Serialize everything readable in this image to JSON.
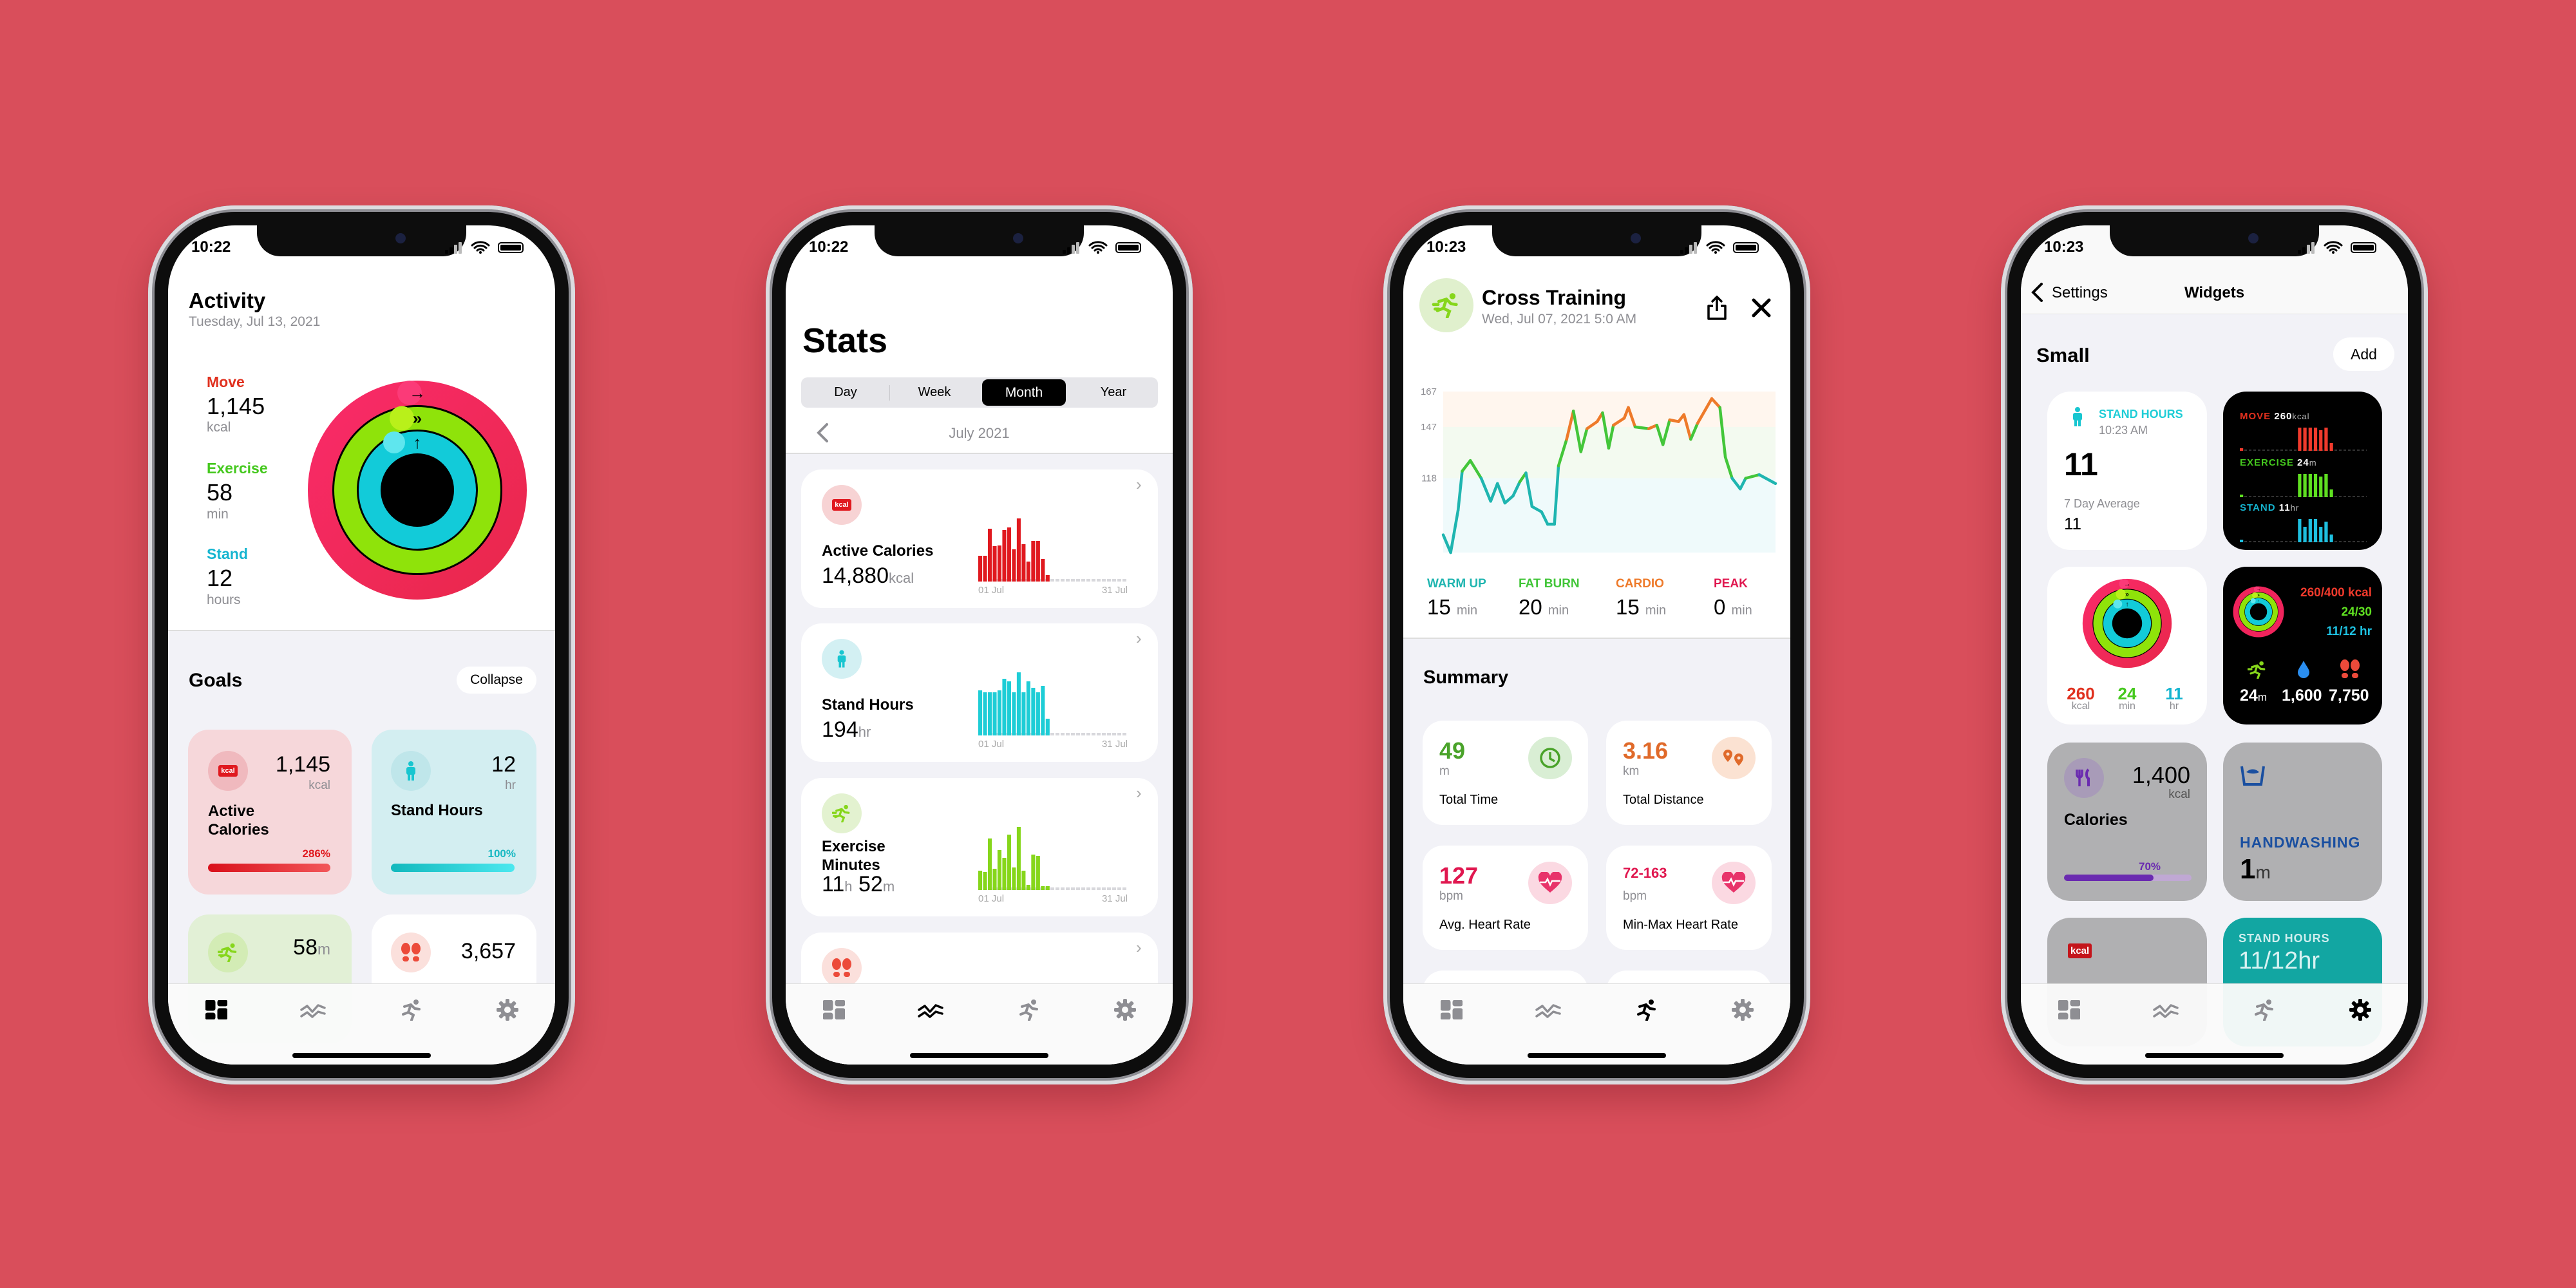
{
  "colors": {
    "background": "#d94e5b",
    "move": "#f0245c",
    "exercise": "#8fe30a",
    "stand": "#10c8d8",
    "warm_up": "#1fb5b0",
    "fat_burn": "#43c63a",
    "cardio": "#ee7a2a",
    "peak": "#e0174f"
  },
  "tabs": [
    {
      "icon": "dashboard-icon"
    },
    {
      "icon": "trends-icon"
    },
    {
      "icon": "workout-runner-icon"
    },
    {
      "icon": "settings-gear-icon"
    }
  ],
  "phones": [
    {
      "time": "10:22",
      "active_tab": 0
    },
    {
      "time": "10:22",
      "active_tab": 1
    },
    {
      "time": "10:23",
      "active_tab": 2
    },
    {
      "time": "10:23",
      "active_tab": 3
    }
  ],
  "activity": {
    "title": "Activity",
    "date": "Tuesday, Jul 13, 2021",
    "move": {
      "label": "Move",
      "value": "1,145",
      "unit": "kcal"
    },
    "exercise": {
      "label": "Exercise",
      "value": "58",
      "unit": "min"
    },
    "stand": {
      "label": "Stand",
      "value": "12",
      "unit": "hours"
    },
    "goals_title": "Goals",
    "collapse_label": "Collapse",
    "cards": [
      {
        "title": "Active Calories",
        "value": "1,145",
        "unit": "kcal",
        "percent": "286%",
        "progress": 286,
        "icon_text": "kcal"
      },
      {
        "title": "Stand Hours",
        "value": "12",
        "unit": "hr",
        "percent": "100%",
        "progress": 100
      },
      {
        "value": "58",
        "unit": "m"
      },
      {
        "value": "3,657"
      }
    ]
  },
  "stats": {
    "title": "Stats",
    "segments": [
      "Day",
      "Week",
      "Month",
      "Year"
    ],
    "selected_segment": "Month",
    "period": "July 2021",
    "axis_start": "01 Jul",
    "axis_end": "31 Jul",
    "cards": [
      {
        "title": "Active Calories",
        "value": "14,880",
        "unit": "kcal",
        "icon_text": "kcal",
        "color": "#e0191f",
        "daily": [
          40,
          40,
          82,
          55,
          56,
          80,
          84,
          50,
          98,
          58,
          31,
          63,
          63,
          35,
          10
        ]
      },
      {
        "title": "Stand Hours",
        "value": "194",
        "unit": "hr",
        "color": "#1ecdd6",
        "daily": [
          70,
          67,
          67,
          67,
          70,
          88,
          84,
          67,
          98,
          67,
          84,
          74,
          67,
          77,
          26
        ]
      },
      {
        "title": "Exercise Minutes",
        "value_h": "11",
        "unit_h": "h",
        "value_m": "52",
        "unit_m": "m",
        "color": "#86d61b",
        "daily": [
          30,
          28,
          80,
          33,
          62,
          50,
          86,
          35,
          98,
          30,
          8,
          55,
          53,
          6,
          6
        ]
      },
      {
        "title": ""
      }
    ]
  },
  "workout": {
    "title": "Cross Training",
    "date": "Wed, Jul 07, 2021 5:0 AM",
    "chart_data": {
      "type": "line",
      "y_ticks": [
        "167",
        "147",
        "118"
      ],
      "ylim": [
        76,
        167
      ],
      "xlim": [
        0,
        49
      ],
      "zones": [
        {
          "from": 118,
          "to": 147,
          "name": "fat burn"
        },
        {
          "from": 147,
          "to": 167,
          "name": "cardio"
        }
      ],
      "x": [
        0,
        1.1,
        2.2,
        2.8,
        4.0,
        5.6,
        7.0,
        8.0,
        9.1,
        10.3,
        11.3,
        12.2,
        13.1,
        14.5,
        15.4,
        16.4,
        17.0,
        18.2,
        19.2,
        20.3,
        21.2,
        22.7,
        23.5,
        24.4,
        25.1,
        26.7,
        27.3,
        28.3,
        30.3,
        31.5,
        32.4,
        33.4,
        34.7,
        35.5,
        36.5,
        37.5,
        39.6,
        40.8,
        41.6,
        42.6,
        43.8,
        44.6,
        46.6,
        49
      ],
      "y": [
        86,
        76,
        100,
        122,
        128,
        118,
        105,
        115,
        104,
        108,
        116,
        121,
        102,
        99,
        92,
        92,
        125,
        140,
        156,
        133,
        146,
        150,
        155,
        135,
        148,
        152,
        158,
        147,
        146,
        148,
        137,
        151,
        150,
        154,
        140,
        149,
        163,
        158,
        130,
        118,
        112,
        118,
        120,
        115
      ]
    },
    "zones": [
      {
        "label": "WARM UP",
        "value": "15",
        "unit": "min",
        "color": "#1fb5b0"
      },
      {
        "label": "FAT BURN",
        "value": "20",
        "unit": "min",
        "color": "#43c63a"
      },
      {
        "label": "CARDIO",
        "value": "15",
        "unit": "min",
        "color": "#ee7a2a"
      },
      {
        "label": "PEAK",
        "value": "0",
        "unit": "min",
        "color": "#e0174f"
      }
    ],
    "summary_title": "Summary",
    "summary": [
      {
        "value": "49",
        "unit": "m",
        "label": "Total Time",
        "color": "#4aa32a",
        "icon": "clock-icon"
      },
      {
        "value": "3.16",
        "unit": "km",
        "label": "Total Distance",
        "color": "#e06a2a",
        "icon": "map-pin-icon"
      },
      {
        "value": "127",
        "unit": "bpm",
        "label": "Avg. Heart Rate",
        "color": "#e0174f",
        "icon": "heart-rate-icon"
      },
      {
        "value": "72-163",
        "unit": "bpm",
        "label": "Min-Max Heart Rate",
        "color": "#e0174f",
        "icon": "heart-rate-icon"
      }
    ]
  },
  "widgets": {
    "back_label": "Settings",
    "title": "Widgets",
    "section": "Small",
    "add_label": "Add",
    "stand": {
      "title": "STAND HOURS",
      "time": "10:23 AM",
      "value": "11",
      "avg_label": "7 Day Average",
      "avg_value": "11"
    },
    "bars": {
      "move": {
        "label": "MOVE",
        "value": "260",
        "unit": "kcal",
        "hourly": [
          1,
          0,
          0,
          0,
          0,
          0,
          0,
          0,
          0,
          0,
          0,
          9,
          9,
          9,
          9,
          8,
          9,
          3,
          0,
          0,
          0,
          0,
          0,
          0
        ]
      },
      "exercise": {
        "label": "EXERCISE",
        "value": "24",
        "unit": "m",
        "hourly": [
          1,
          0,
          0,
          0,
          0,
          0,
          0,
          0,
          0,
          0,
          0,
          9,
          9,
          9,
          9,
          8,
          9,
          3,
          0,
          0,
          0,
          0,
          0,
          0
        ]
      },
      "stand": {
        "label": "STAND",
        "value": "11",
        "unit": "hr",
        "hourly": [
          1,
          0,
          0,
          0,
          0,
          0,
          0,
          0,
          0,
          0,
          0,
          9,
          6,
          9,
          9,
          6,
          8,
          3,
          0,
          0,
          0,
          0,
          0,
          0
        ]
      }
    },
    "rings": {
      "move": "260",
      "move_unit": "kcal",
      "exercise": "24",
      "exercise_unit": "min",
      "stand": "11",
      "stand_unit": "hr"
    },
    "dark_rings": {
      "move": "260/400 kcal",
      "exercise": "24/30",
      "stand": "11/12 hr",
      "exercise_value": "24",
      "exercise_unit": "m",
      "water": "1,600",
      "steps": "7,750"
    },
    "calories": {
      "value": "1,400",
      "unit": "kcal",
      "label": "Calories",
      "percent": "70%",
      "progress": 70
    },
    "handwashing": {
      "label": "HANDWASHING",
      "value": "1",
      "unit": "m"
    },
    "kcal_widget": {
      "icon_text": "kcal"
    },
    "stand_teal": {
      "label": "STAND HOURS",
      "value": "11/12hr"
    }
  }
}
